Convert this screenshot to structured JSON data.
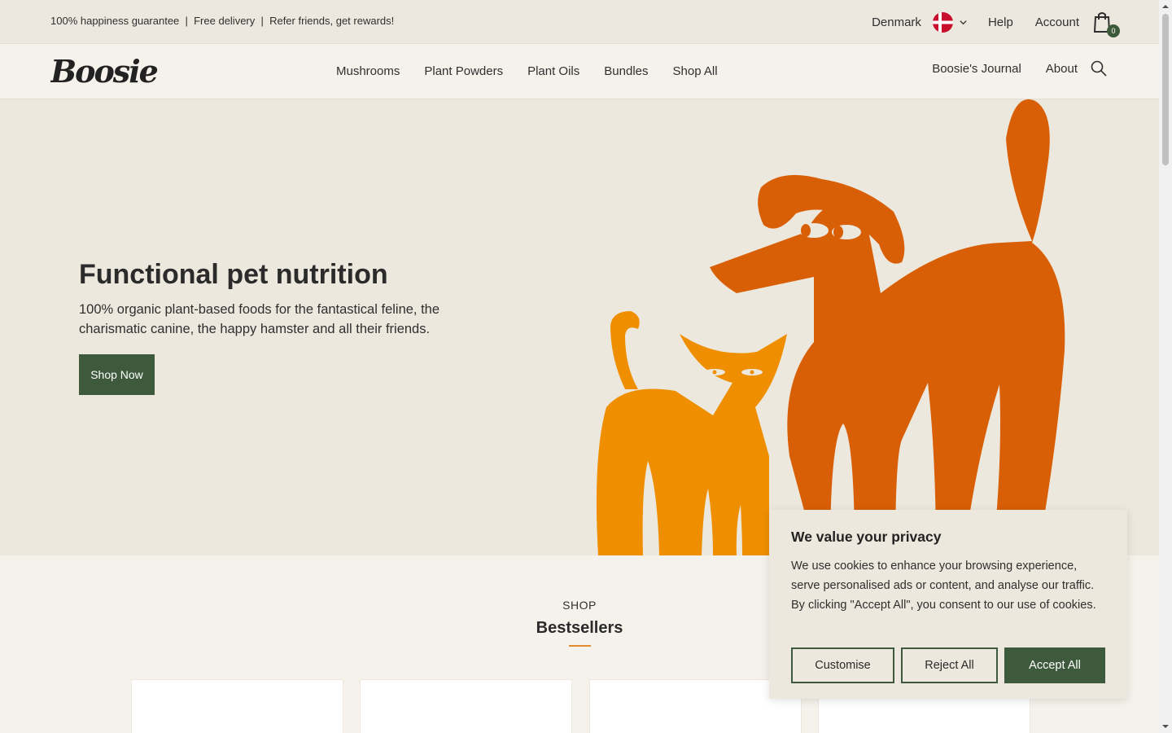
{
  "announcement": {
    "message": "100% happiness guarantee  |  Free delivery  |  Refer friends, get rewards!"
  },
  "utility_nav": {
    "country": "Denmark",
    "flag_icon": "denmark-flag-icon",
    "help": "Help",
    "account": "Account",
    "cart_count": "0"
  },
  "header": {
    "logo_text": "Boosie",
    "nav": [
      "Mushrooms",
      "Plant Powders",
      "Plant Oils",
      "Bundles",
      "Shop All"
    ],
    "secondary_nav": [
      "Boosie's Journal",
      "About"
    ]
  },
  "hero": {
    "title": "Functional pet nutrition",
    "subtitle": "100% organic plant-based foods for the fantastical feline, the charismatic canine, the happy hamster and all their friends.",
    "cta": "Shop Now"
  },
  "shop": {
    "eyebrow": "SHOP",
    "title": "Bestsellers"
  },
  "cookie_banner": {
    "title": "We value your privacy",
    "body": "We use cookies to enhance your browsing experience, serve personalised ads or content, and analyse our traffic. By clicking \"Accept All\", you consent to our use of cookies.",
    "customise": "Customise",
    "reject": "Reject All",
    "accept": "Accept All"
  },
  "colors": {
    "brand_green": "#3e5a3c",
    "accent_orange": "#e08a2b",
    "dog_orange": "#d95f06",
    "cat_orange": "#ef8f00",
    "cream": "#ede8dd"
  }
}
